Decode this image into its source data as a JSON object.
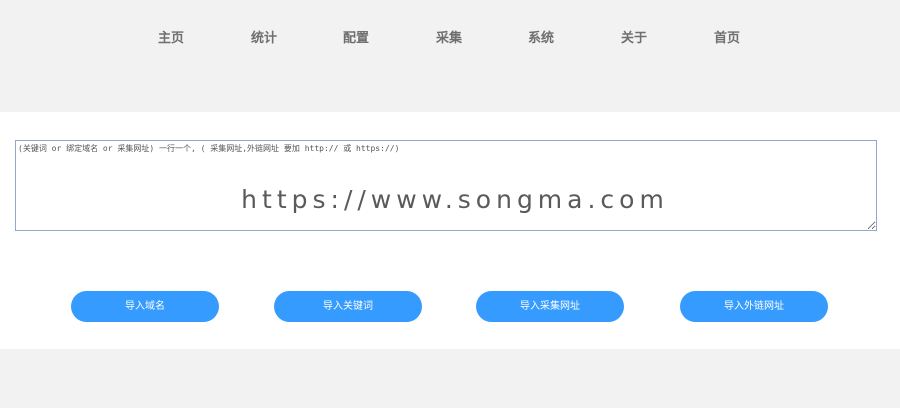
{
  "nav": {
    "items": [
      {
        "label": "主页"
      },
      {
        "label": "统计"
      },
      {
        "label": "配置"
      },
      {
        "label": "采集"
      },
      {
        "label": "系统"
      },
      {
        "label": "关于"
      },
      {
        "label": "首页"
      }
    ]
  },
  "import_form": {
    "textarea_placeholder": "(关键词 or 绑定域名 or 采集网址) 一行一个, ( 采集网址,外链网址 要加 http:// 或 https://)",
    "watermark": "https://www.songma.com",
    "buttons": {
      "import_domain": "导入域名",
      "import_keywords": "导入关键词",
      "import_collect_url": "导入采集网址",
      "import_external_link": "导入外链网址"
    }
  },
  "colors": {
    "button_bg": "#359bff",
    "page_bg": "#f2f2f2",
    "panel_bg": "#ffffff",
    "nav_text": "#6f6f6f"
  }
}
